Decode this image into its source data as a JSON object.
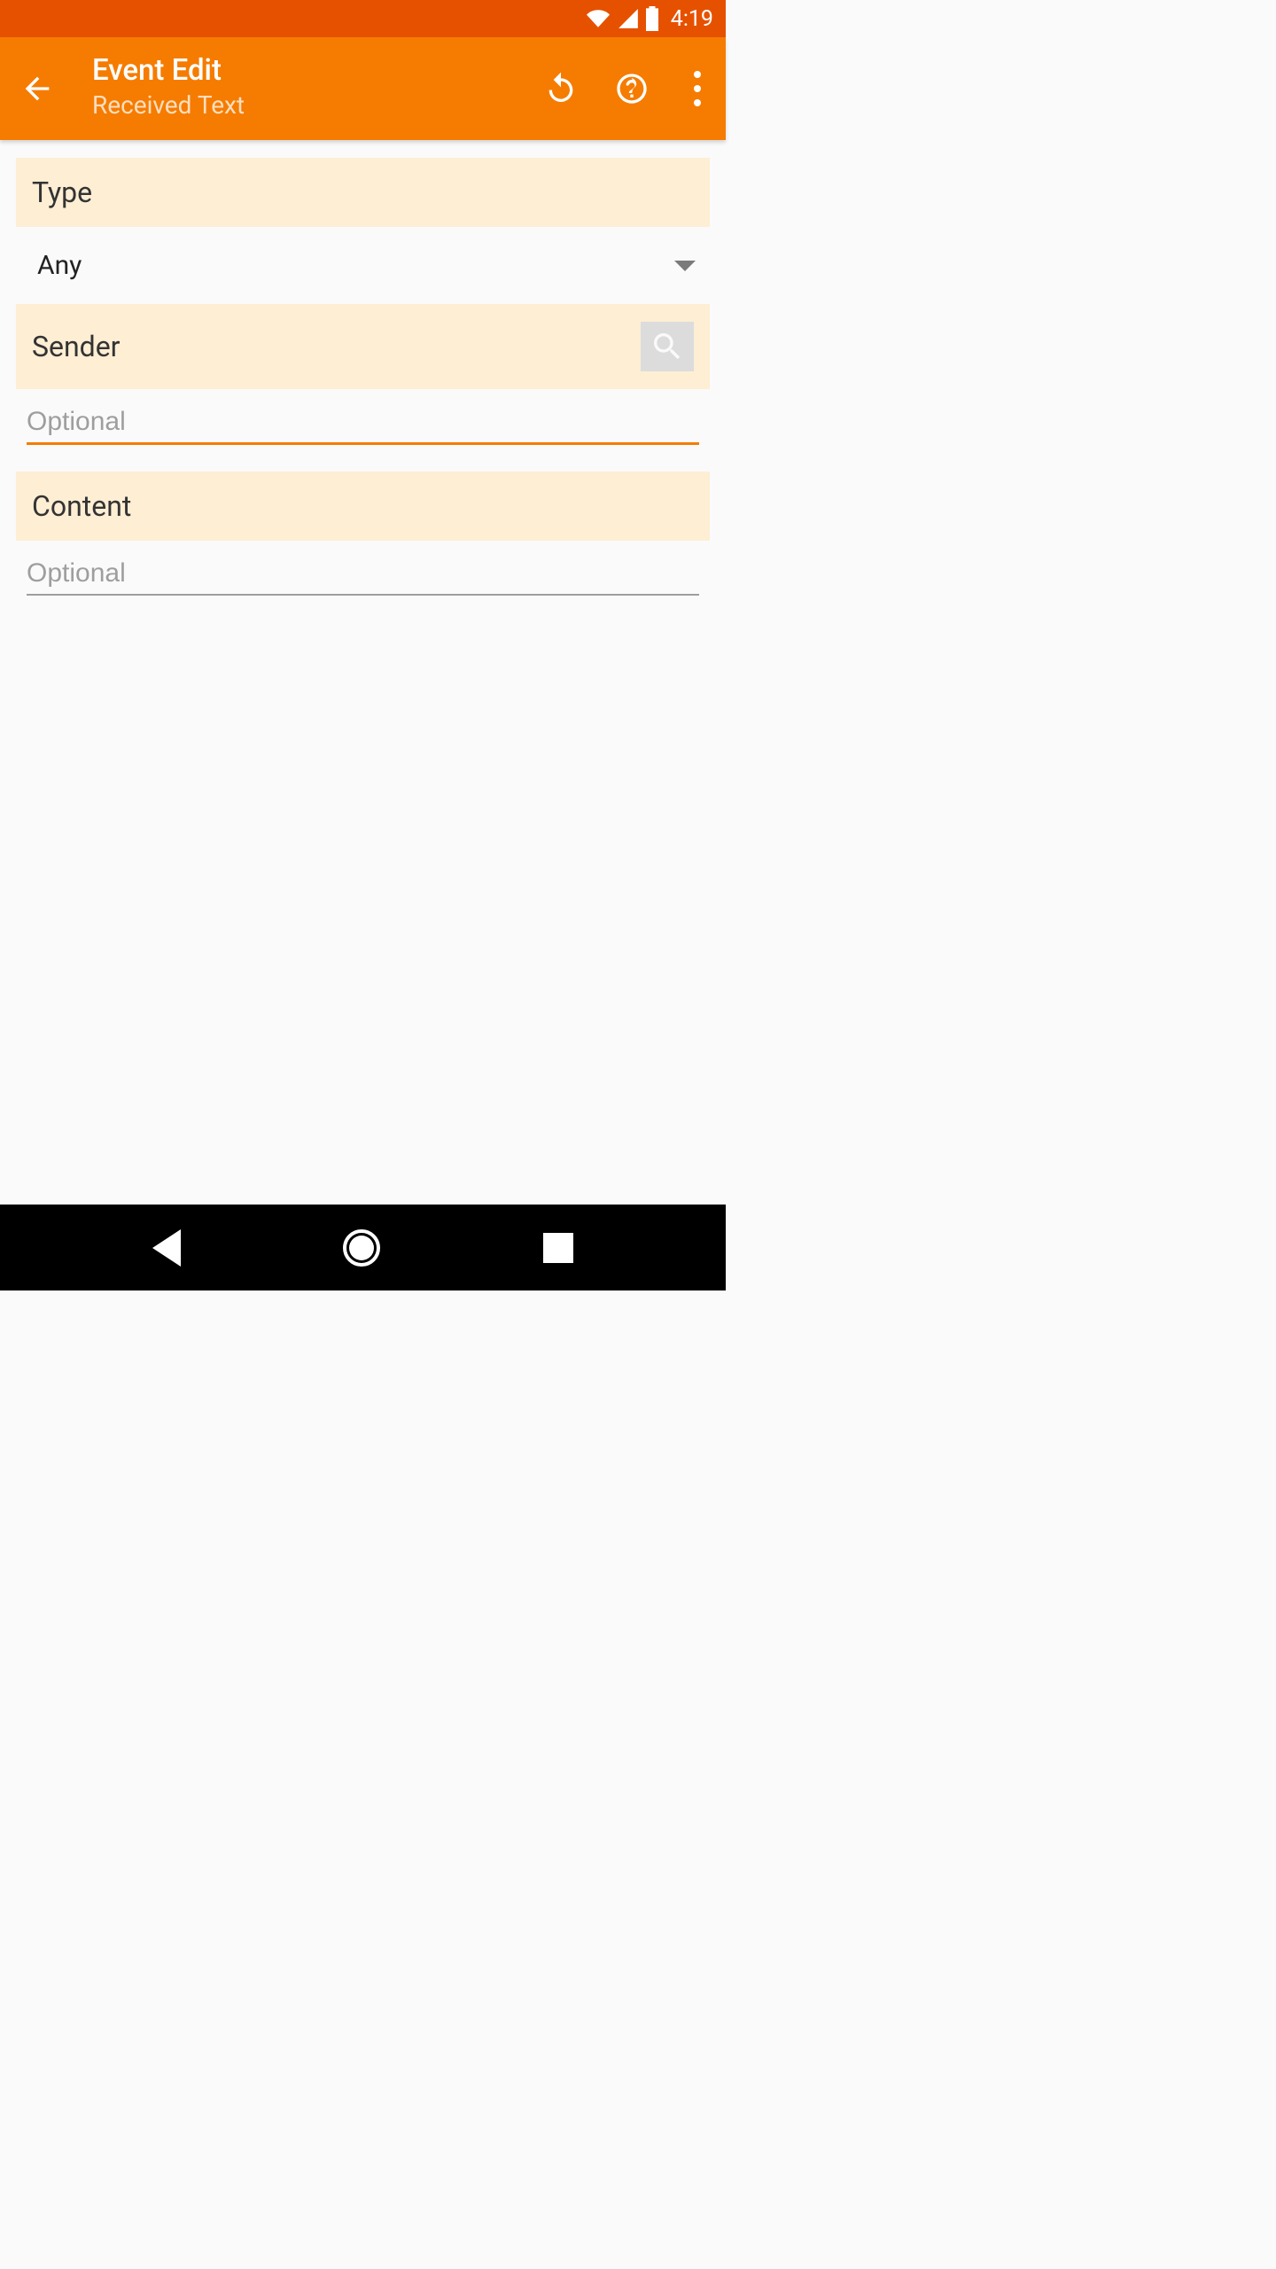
{
  "status": {
    "time": "4:19"
  },
  "appbar": {
    "title": "Event Edit",
    "subtitle": "Received Text"
  },
  "sections": {
    "type": {
      "label": "Type",
      "value": "Any"
    },
    "sender": {
      "label": "Sender",
      "placeholder": "Optional",
      "value": ""
    },
    "content": {
      "label": "Content",
      "placeholder": "Optional",
      "value": ""
    }
  }
}
